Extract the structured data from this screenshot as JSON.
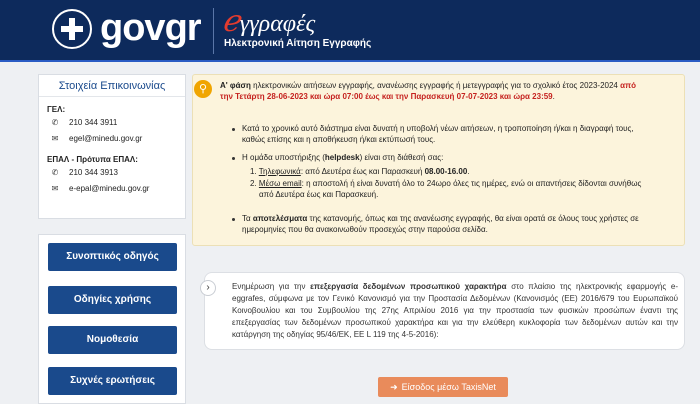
{
  "header": {
    "logo_gov": "gov",
    "logo_gr": "gr",
    "brand_initial": "ℯ",
    "brand_rest": "γγραφές",
    "brand_subtitle": "Ηλεκτρονική Αίτηση Εγγραφής"
  },
  "contact": {
    "title": "Στοιχεία Επικοινωνίας",
    "groups": [
      {
        "label": "ΓΕΛ:",
        "phone": "210 344 3911",
        "email": "egel@minedu.gov.gr"
      },
      {
        "label": "ΕΠΑΛ - Πρότυπα ΕΠΑΛ:",
        "phone": "210 344 3913",
        "email": "e-epal@minedu.gov.gr"
      }
    ]
  },
  "sidebar": {
    "buttons": [
      "Συνοπτικός οδηγός",
      "Οδηγίες χρήσης",
      "Νομοθεσία",
      "Συχνές ερωτήσεις"
    ]
  },
  "notice": {
    "phase_bold": "Α' φάση",
    "phase_text": " ηλεκτρονικών αιτήσεων εγγραφής, ανανέωσης εγγραφής ή μετεγγραφής για το σχολικό έτος 2023-2024 ",
    "phase_red_1": "από",
    "phase_red_2": "την Τετάρτη 28-06-2023 και ώρα 07:00 έως και την Παρασκευή 07-07-2023 και ώρα 23:59",
    "phase_end": ".",
    "bullet1_l1": "Κατά το χρονικό αυτό διάστημα είναι δυνατή η υποβολή νέων αιτήσεων, η τροποποίηση ή/και η διαγραφή τους,",
    "bullet1_l2": "καθώς επίσης και η αποθήκευση ή/και εκτύπωσή τους.",
    "bullet2_pre": "Η ομάδα υποστήριξης (",
    "bullet2_bold": "helpdesk",
    "bullet2_post": ") είναι στη διάθεσή σας:",
    "sub1_num": "1.",
    "sub1_link": "Τηλεφωνικά",
    "sub1_text": ": από Δευτέρα έως και Παρασκευή ",
    "sub1_bold": "08.00-16.00",
    "sub1_end": ".",
    "sub2_num": "2.",
    "sub2_link": "Μέσω email",
    "sub2_text": ": η αποστολή ή είναι δυνατή όλο το 24ωρο όλες τις ημέρες, ενώ οι απαντήσεις δίδονται συνήθως",
    "sub2_l2": "από Δευτέρα έως και Παρασκευή.",
    "bullet3_pre": "Τα ",
    "bullet3_bold": "αποτελέσματα",
    "bullet3_post": " της κατανομής, όπως και της ανανέωσης εγγραφής, θα είναι ορατά σε όλους τους χρήστες σε",
    "bullet3_l2": "ημερομηνίες που θα ανακοινωθούν προσεχώς στην παρούσα σελίδα."
  },
  "info": {
    "pre": "Ενημέρωση για την ",
    "bold": "επεξεργασία δεδομένων προσωπικού χαρακτήρα",
    "post": " στο πλαίσιο της ηλεκτρονικής εφαρμογής e-eggrafes, σύμφωνα με τον Γενικό Κανονισμό για την Προστασία Δεδομένων (Κανονισμός (ΕΕ) 2016/679 του Ευρωπαϊκού Κοινοβουλίου και του Συμβουλίου της 27ης Απριλίου 2016 για την προστασία των φυσικών προσώπων έναντι της επεξεργασίας των δεδομένων προσωπικού χαρακτήρα και για την ελεύθερη κυκλοφορία των δεδομένων αυτών και την κατάργηση της οδηγίας 95/46/ΕΚ, ΕΕ L 119 της 4-5-2016):"
  },
  "taxis": {
    "label": "Είσοδος μέσω TaxisNet"
  },
  "colors": {
    "header": "#0d2a5c",
    "button": "#1a4a8c",
    "notice_bg": "#fcf4dc",
    "accent_red": "#c5221f",
    "taxis": "#e98b5b"
  },
  "icons": [
    "greek-emblem-icon",
    "phone-icon",
    "email-icon",
    "lightbulb-icon",
    "chevron-right-icon",
    "login-icon"
  ]
}
